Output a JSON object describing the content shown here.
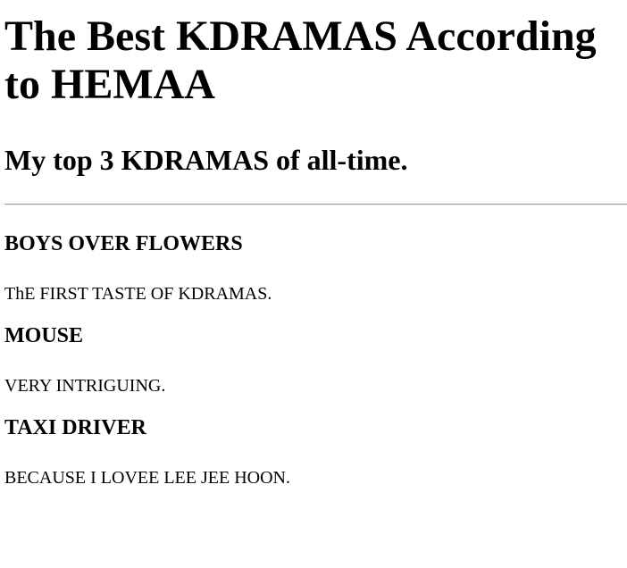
{
  "page": {
    "title": "The Best KDRAMAS According to HEMAA",
    "subtitle": "My top 3 KDRAMAS of all-time."
  },
  "dramas": [
    {
      "title": "BOYS OVER FLOWERS",
      "description": "ThE FIRST TASTE OF KDRAMAS."
    },
    {
      "title": "MOUSE",
      "description": "VERY INTRIGUING."
    },
    {
      "title": "TAXI DRIVER",
      "description": "BECAUSE I LOVEE LEE JEE HOON."
    }
  ]
}
